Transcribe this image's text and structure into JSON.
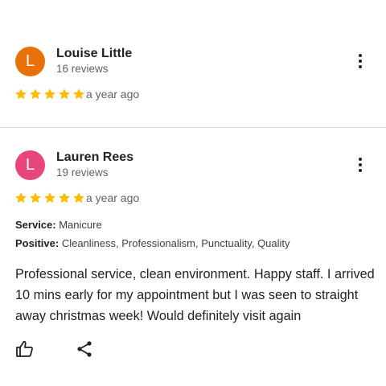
{
  "reviews": [
    {
      "avatar_letter": "L",
      "avatar_color": "#e8710a",
      "name": "Louise Little",
      "review_count": "16 reviews",
      "rating": 5,
      "date": "a year ago"
    },
    {
      "avatar_letter": "L",
      "avatar_color": "#e8457a",
      "name": "Lauren Rees",
      "review_count": "19 reviews",
      "rating": 5,
      "date": "a year ago",
      "service_label": "Service:",
      "service_value": "Manicure",
      "positive_label": "Positive:",
      "positive_value": "Cleanliness, Professionalism, Punctuality, Quality",
      "text": "Professional service, clean environment. Happy staff. I arrived 10 mins early for my appointment but I was seen to straight away christmas week! Would definitely visit again"
    }
  ],
  "icons": {
    "star": "star-icon",
    "more": "more-vert-icon",
    "like": "thumb-up-icon",
    "share": "share-icon"
  },
  "colors": {
    "star": "#fbbc04",
    "divider": "#e0e0e0"
  }
}
